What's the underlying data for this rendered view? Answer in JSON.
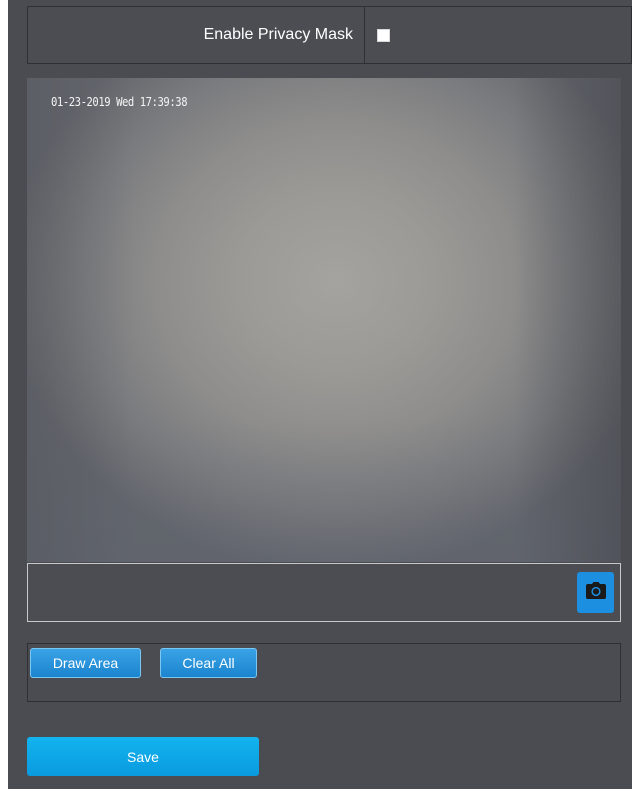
{
  "privacy_mask": {
    "label": "Enable Privacy Mask",
    "checked": false
  },
  "video": {
    "timestamp": "01-23-2019 Wed 17:39:38"
  },
  "video_toolbar": {
    "snapshot_icon": "camera-icon"
  },
  "draw_controls": {
    "draw_area_label": "Draw Area",
    "clear_all_label": "Clear All"
  },
  "actions": {
    "save_label": "Save"
  },
  "colors": {
    "panel_bg": "#4a4c52",
    "accent": "#1d8fe0",
    "save": "#0a9ade"
  }
}
